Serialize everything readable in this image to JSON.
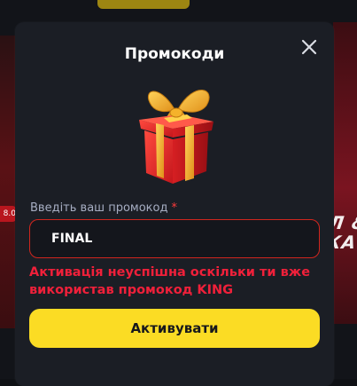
{
  "modal": {
    "title": "Промокоди",
    "field_label": "Введіть ваш промокод",
    "required_marker": "*",
    "input_value": "FINAL",
    "error_message": "Активація неуспішна оскільки ти вже використав промокод KING",
    "activate_label": "Активувати",
    "close_icon": "close-icon",
    "gift_icon": "gift-box-icon"
  },
  "background": {
    "left_badge": "8.0",
    "right_text": "Л &\nКА"
  },
  "colors": {
    "modal_bg": "#1b1e25",
    "accent_yellow": "#fbdc24",
    "error_red": "#f0203a",
    "input_border": "#d0261e"
  }
}
